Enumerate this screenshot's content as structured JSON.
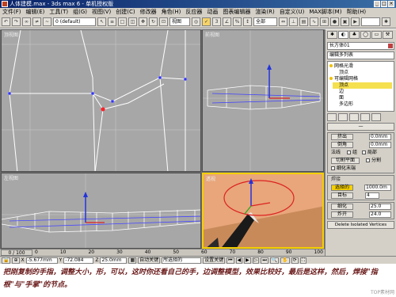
{
  "window": {
    "title": "人体建模.max - 3ds max 6 - 单机授权版",
    "controls": [
      "_",
      "□",
      "×"
    ]
  },
  "menu": [
    "文件(F)",
    "编辑(E)",
    "工具(T)",
    "组(G)",
    "视图(V)",
    "创建(C)",
    "修改器",
    "角色(H)",
    "反应器",
    "动画",
    "图表编辑器",
    "渲染(R)",
    "自定义(U)",
    "MAX脚本(M)",
    "帮助(H)"
  ],
  "toolbar": {
    "selection_filter": "全部",
    "view_dropdown": "视图",
    "named_selection": "0 (default)"
  },
  "viewports": {
    "top": "顶视图",
    "front": "前视图",
    "left": "左视图",
    "perspective": "透视"
  },
  "command_panel": {
    "object_name": "长方体01",
    "modifier_list": "编辑多列表",
    "stack": [
      {
        "label": "网格光滑",
        "level": 0,
        "selected": false
      },
      {
        "label": "顶点",
        "level": 1,
        "selected": false
      },
      {
        "label": "可编辑网格",
        "level": 0,
        "selected": false
      },
      {
        "label": "顶点",
        "level": 1,
        "selected": true
      },
      {
        "label": "边",
        "level": 1,
        "selected": false
      },
      {
        "label": "面",
        "level": 1,
        "selected": false
      },
      {
        "label": "多边形",
        "level": 1,
        "selected": false
      }
    ],
    "extrude_label": "挤出",
    "extrude_value": "0.0mm",
    "chamfer_label": "倒角",
    "chamfer_value": "0.0mm",
    "normal_label": "法线",
    "group_label": "组",
    "local_label": "局部",
    "slice_plane_label": "切割平面",
    "split_label": "分割",
    "refine_ends_label": "细化末端",
    "weld_section": "焊接",
    "weld_selected_label": "选择的",
    "weld_selected_value": "1000.0m",
    "weld_target_label": "目标",
    "weld_target_value": "4",
    "tessellate_label": "细化",
    "tessellate_value": "25.0",
    "explode_label": "炸开",
    "explode_value": "24.0",
    "remove_isolated": "Delete Isolated Vertices"
  },
  "timeline": {
    "frame": "0 / 100",
    "ticks": [
      "0",
      "10",
      "20",
      "30",
      "40",
      "50",
      "60",
      "70",
      "80",
      "90",
      "100"
    ]
  },
  "status": {
    "x": "-5.677mm",
    "y": "-72.084",
    "z": "25.0mm",
    "auto_key": "自动关键",
    "selected": "所选择的",
    "set_key": "设置关键"
  },
  "caption": {
    "text": "把刚复制的手指，调整大小，形，可以，这时你还看自己的手，边调整模型，效果比较好，最后是这样，然后，焊接\"指根\"与\"手掌\"的节点。",
    "watermark": "TOP素材网"
  }
}
